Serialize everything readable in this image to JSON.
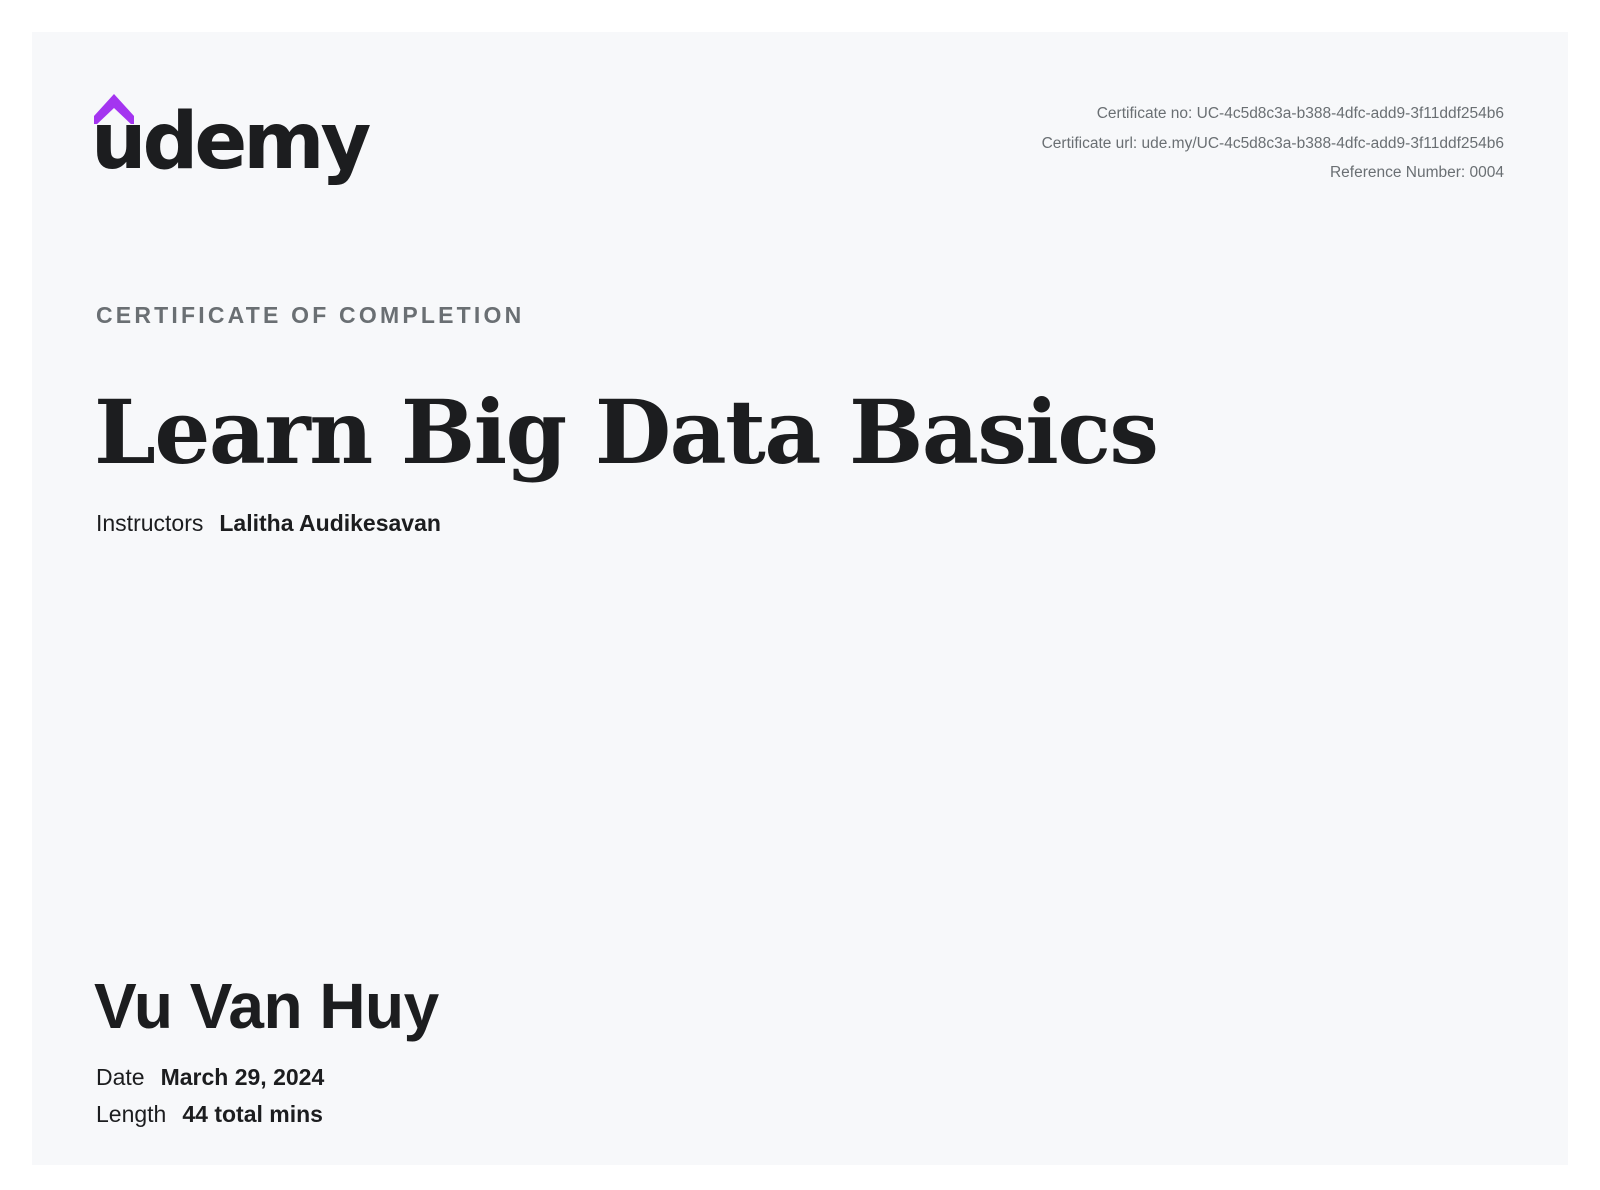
{
  "brand": {
    "logo_text": "udemy",
    "logo_accent_color": "#a435f0",
    "text_color": "#1c1d1f"
  },
  "meta": {
    "certificate_no": "Certificate no: UC-4c5d8c3a-b388-4dfc-add9-3f11ddf254b6",
    "certificate_url": "Certificate url: ude.my/UC-4c5d8c3a-b388-4dfc-add9-3f11ddf254b6",
    "reference_number": "Reference Number: 0004"
  },
  "certificate": {
    "label": "CERTIFICATE OF COMPLETION",
    "course_title": "Learn Big Data Basics",
    "instructors_label": "Instructors",
    "instructors": "Lalitha Audikesavan",
    "recipient": "Vu Van Huy",
    "date_label": "Date",
    "date": "March 29, 2024",
    "length_label": "Length",
    "length": "44 total mins"
  }
}
